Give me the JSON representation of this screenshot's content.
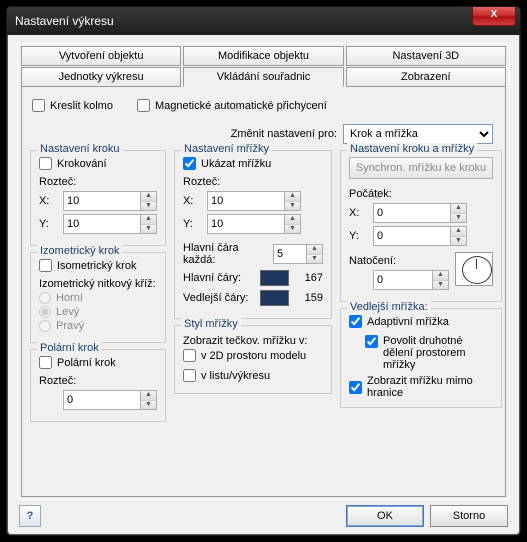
{
  "window": {
    "title": "Nastavení výkresu",
    "close": "X"
  },
  "tabs_row1": [
    "Vytvoření objektu",
    "Modifikace objektu",
    "Nastavení 3D"
  ],
  "tabs_row2": [
    "Jednotky výkresu",
    "Vkládání souřadnic",
    "Zobrazení"
  ],
  "active_tab": "Vkládání souřadnic",
  "top": {
    "ortho": "Kreslit kolmo",
    "snap": "Magnetické automatické přichycení"
  },
  "change_for": {
    "label": "Změnit nastavení pro:",
    "value": "Krok a mřížka"
  },
  "krok": {
    "title": "Nastavení kroku",
    "step": "Krokování",
    "pitch": "Rozteč:",
    "x": "10",
    "y": "10"
  },
  "iso": {
    "title": "Izometrický krok",
    "chk": "Isometrický krok",
    "cross": "Izometrický nitkový kříž:",
    "r1": "Horní",
    "r2": "Levý",
    "r3": "Pravý"
  },
  "polar": {
    "title": "Polární krok",
    "chk": "Polární krok",
    "pitch": "Rozteč:",
    "val": "0"
  },
  "mrizka": {
    "title": "Nastavení mřížky",
    "show": "Ukázat mřížku",
    "pitch": "Rozteč:",
    "x": "10",
    "y": "10",
    "major_every": "Hlavní čára každá:",
    "major_every_val": "5",
    "major_lines": "Hlavní čáry:",
    "major_val": "167",
    "minor_lines": "Vedlejší čáry:",
    "minor_val": "159"
  },
  "style": {
    "title": "Styl mřížky",
    "subtitle": "Zobrazit tečkov. mřížku v:",
    "opt1": "v 2D prostoru modelu",
    "opt2": "v listu/výkresu"
  },
  "km": {
    "title": "Nastavení kroku a mřížky",
    "sync": "Synchron. mřížku ke kroku",
    "origin": "Počátek:",
    "x": "0",
    "y": "0",
    "rotation": "Natočení:",
    "rot_val": "0"
  },
  "secondary": {
    "title": "Vedlejší mřížka:",
    "adaptive": "Adaptivní mřížka",
    "allow_sub": "Povolit druhotné dělení prostorem mřížky",
    "beyond": "Zobrazit mřížku mimo hranice"
  },
  "footer": {
    "help": "?",
    "ok": "OK",
    "cancel": "Storno"
  },
  "labels": {
    "x": "X:",
    "y": "Y:"
  }
}
